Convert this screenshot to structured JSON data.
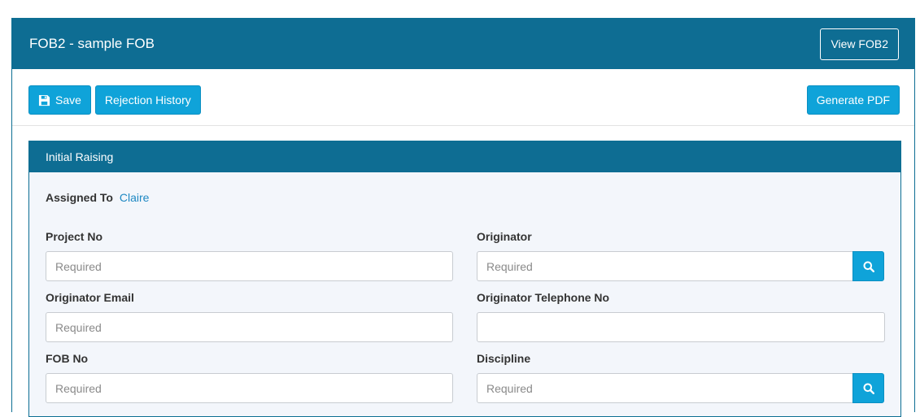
{
  "header": {
    "title": "FOB2 - sample FOB",
    "view_button": "View FOB2"
  },
  "toolbar": {
    "save_label": "Save",
    "rejection_history_label": "Rejection History",
    "generate_pdf_label": "Generate PDF"
  },
  "panel": {
    "title": "Initial Raising",
    "assigned_label": "Assigned To",
    "assigned_value": "Claire",
    "fields": {
      "project_no": {
        "label": "Project No",
        "placeholder": "Required"
      },
      "originator": {
        "label": "Originator",
        "placeholder": "Required"
      },
      "originator_email": {
        "label": "Originator Email",
        "placeholder": "Required"
      },
      "originator_tel": {
        "label": "Originator Telephone No",
        "placeholder": ""
      },
      "fob_no": {
        "label": "FOB No",
        "placeholder": "Required"
      },
      "discipline": {
        "label": "Discipline",
        "placeholder": "Required"
      }
    }
  },
  "colors": {
    "header_blue": "#0e6d93",
    "button_blue": "#0fa3d9",
    "link_blue": "#1e88c3"
  },
  "icons": {
    "save": "floppy-disk-icon",
    "search": "magnifier-icon"
  }
}
